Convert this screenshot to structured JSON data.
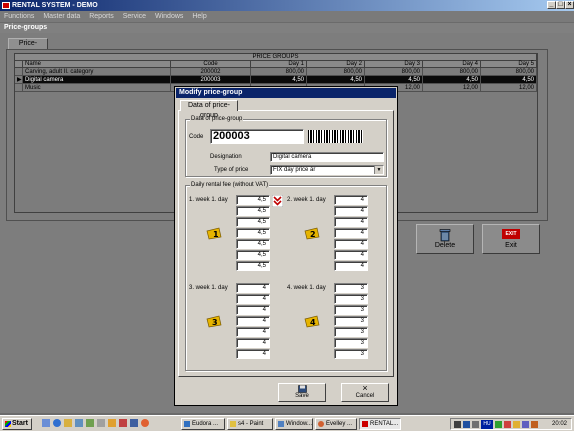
{
  "app": {
    "title": "RENTAL SYSTEM - DEMO",
    "menu": [
      "Functions",
      "Master data",
      "Reports",
      "Service",
      "Windows",
      "Help"
    ]
  },
  "pricegroups_window": {
    "title": "Price-groups",
    "tab": "Price-groups",
    "grid_caption": "PRICE GROUPS",
    "columns": [
      "Name",
      "Code",
      "Day 1",
      "Day 2",
      "Day 3",
      "Day 4",
      "Day 5"
    ],
    "rows": [
      {
        "name": "Carving, adult II. category",
        "code": "200002",
        "d1": "800,00",
        "d2": "800,00",
        "d3": "800,00",
        "d4": "800,00",
        "d5": "800,00",
        "selected": false
      },
      {
        "name": "Digital camera",
        "code": "200003",
        "d1": "4,50",
        "d2": "4,50",
        "d3": "4,50",
        "d4": "4,50",
        "d5": "4,50",
        "selected": true
      },
      {
        "name": "Music",
        "code": "",
        "d1": "",
        "d2": "",
        "d3": "12,00",
        "d4": "12,00",
        "d5": "12,00",
        "selected": false
      }
    ],
    "buttons": {
      "delete": "Delete",
      "exit": "Exit",
      "exit_badge": "EXIT"
    }
  },
  "dialog": {
    "title": "Modify price-group",
    "tab": "Data of price-group",
    "group_data": "Data of price-group",
    "code_label": "Code",
    "code_value": "200003",
    "designation_label": "Designation",
    "designation_value": "Digital camera",
    "type_label": "Type of price",
    "type_value": "FIX day price ár",
    "group_fee": "Daily rental fee (without VAT)",
    "week1_label": "1. week  1. day",
    "week2_label": "2. week 1. day",
    "week3_label": "3. week 1. day",
    "week4_label": "4. week 1. day",
    "week1_values": [
      "4,5",
      "4,5",
      "4,5",
      "4,5",
      "4,5",
      "4,5",
      "4,5"
    ],
    "week2_values": [
      "4",
      "4",
      "4",
      "4",
      "4",
      "4",
      "4"
    ],
    "week3_values": [
      "4",
      "4",
      "4",
      "4",
      "4",
      "4",
      "4"
    ],
    "week4_values": [
      "3",
      "3",
      "3",
      "3",
      "3",
      "3",
      "3"
    ],
    "week_badges": [
      "1",
      "2",
      "3",
      "4"
    ],
    "save_label": "Save",
    "cancel_label": "Cancel"
  },
  "taskbar": {
    "start": "Start",
    "tasks": [
      "Eudora ...",
      "s4 - Paint",
      "Window...",
      "Evelley ...",
      "RENTAL..."
    ],
    "tray_lang": "HU",
    "clock": "20:02"
  }
}
